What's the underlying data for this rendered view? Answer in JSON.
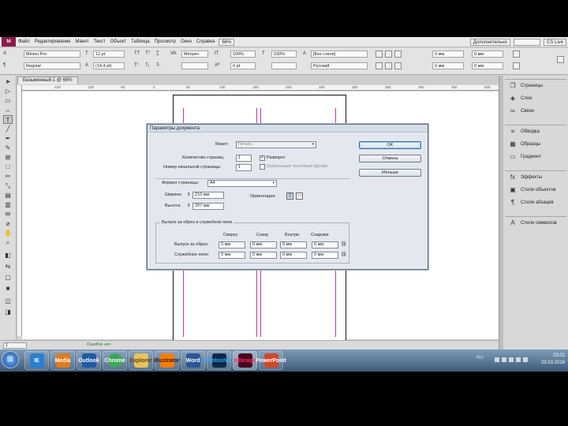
{
  "menubar": {
    "logo": "Id",
    "items": [
      "Файл",
      "Редактирование",
      "Макет",
      "Текст",
      "Объект",
      "Таблица",
      "Просмотр",
      "Окно",
      "Справка"
    ],
    "zoom": "66%",
    "workspace": "Дополнительно",
    "search_placeholder": "",
    "close": "CS Live"
  },
  "control": {
    "font_family": "Minion Pro",
    "font_style": "Regular",
    "font_size": "12 pt",
    "leading": "(14,4 pt)",
    "tracking": "Метрич",
    "scale_v": "100%",
    "scale_h": "100%",
    "baseline": "0 pt",
    "char_style": "[Без стиля]",
    "lang": "Русский",
    "indent_1": "0 мм",
    "indent_2": "0 мм",
    "indent_3": "0 мм",
    "indent_4": "0 мм"
  },
  "doc_tab": "Безымянный-1 @ 66%",
  "ruler_ticks": [
    "-150",
    "-100",
    "-50",
    "0",
    "50",
    "100",
    "150",
    "200",
    "250",
    "300",
    "350",
    "400",
    "450",
    "500",
    "550"
  ],
  "panels": {
    "group1": [
      "Страницы",
      "Слои",
      "Связи"
    ],
    "group2": [
      "Обводка",
      "Образцы",
      "Градиент"
    ],
    "group3": [
      "Эффекты",
      "Стили объектов",
      "Стили абзацев"
    ],
    "group4": [
      "Стили символов"
    ]
  },
  "statusbar": {
    "page": "1",
    "status": "Ошибок нет"
  },
  "taskbar": {
    "apps": [
      "IE",
      "Media",
      "Outlook",
      "Chrome",
      "Explorer",
      "Illustrator",
      "Word",
      "Photoshop",
      "InDesign",
      "PowerPoint"
    ],
    "tray_lang": "RU",
    "time": "23:02",
    "date": "23.03.2016"
  },
  "dialog": {
    "title": "Параметры документа",
    "preset_label": "Макет:",
    "preset_value": "Печать",
    "pages_label": "Количество страниц:",
    "pages_value": "1",
    "facing_label": "Разворот",
    "facing_checked": true,
    "start_label": "Номер начальной страницы:",
    "start_value": "1",
    "master_text_label": "Шаблонный текстовый фрейм",
    "master_text_checked": false,
    "ok": "OK",
    "cancel": "Отмена",
    "more": "Меньше",
    "format_label": "Формат страницы:",
    "format_value": "A4",
    "width_label": "Ширина:",
    "width_value": "210 мм",
    "height_label": "Высота:",
    "height_value": "297 мм",
    "orientation_label": "Ориентация:",
    "bleed_group_title": "Выпуск за обрез и служебное поле",
    "col_top": "Сверху",
    "col_bottom": "Снизу",
    "col_inside": "Внутри",
    "col_outside": "Снаружи",
    "bleed_label": "Выпуск за обрез:",
    "slug_label": "Служебное поле:",
    "bleed_top": "0 мм",
    "bleed_bottom": "0 мм",
    "bleed_inside": "0 мм",
    "bleed_outside": "0 мм",
    "slug_top": "0 мм",
    "slug_bottom": "0 мм",
    "slug_inside": "0 мм",
    "slug_outside": "0 мм"
  }
}
